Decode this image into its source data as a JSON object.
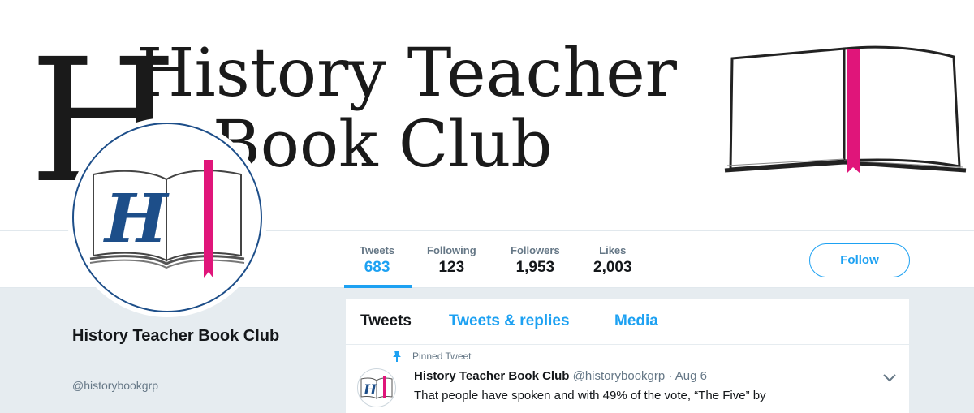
{
  "banner": {
    "title_line1": "History Teacher",
    "title_line2": "Book Club"
  },
  "stats": [
    {
      "label": "Tweets",
      "value": "683"
    },
    {
      "label": "Following",
      "value": "123"
    },
    {
      "label": "Followers",
      "value": "1,953"
    },
    {
      "label": "Likes",
      "value": "2,003"
    }
  ],
  "follow_button": "Follow",
  "profile": {
    "name": "History Teacher Book Club",
    "handle": "@historybookgrp"
  },
  "tabs": [
    {
      "label": "Tweets"
    },
    {
      "label": "Tweets & replies"
    },
    {
      "label": "Media"
    }
  ],
  "tweet": {
    "pinned_label": "Pinned Tweet",
    "author": "History Teacher Book Club",
    "handle_date": "@historybookgrp · Aug 6",
    "text": "That people have spoken and with 49% of the vote, “The Five” by"
  },
  "colors": {
    "accent": "#1da1f2",
    "bookmark": "#e0157a",
    "logo_letter": "#1d4e89"
  }
}
